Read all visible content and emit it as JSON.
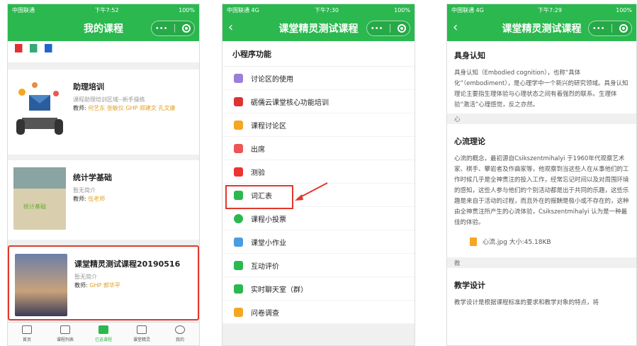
{
  "statusbar": {
    "p1": {
      "carrier": "中国联通",
      "time": "下午7:52",
      "battery": "100%"
    },
    "p2": {
      "carrier": "中国联通 4G",
      "time": "下午7:30",
      "battery": "100%"
    },
    "p3": {
      "carrier": "中国联通 4G",
      "time": "下午7:29",
      "battery": "100%"
    }
  },
  "screen1": {
    "title": "我的课程",
    "courses": [
      {
        "title": "助理培训",
        "desc": "课程助理培训区域--新手操练",
        "teacher_label": "教师:",
        "teachers": "何艺东 张敏仪 GHP 郑建文 孔文康"
      },
      {
        "title": "统计学基础",
        "desc": "暂无简介",
        "teacher_label": "教师:",
        "teachers": "伍老师"
      },
      {
        "title": "课堂精灵测试课程20190516",
        "desc": "暂无简介",
        "teacher_label": "教师:",
        "teachers": "GHP 郭华平"
      }
    ],
    "tabs": [
      "首页",
      "课程列表",
      "已选课程",
      "课堂精灵",
      "我的"
    ]
  },
  "screen2": {
    "title": "课堂精灵测试课程",
    "section": "小程序功能",
    "menu": [
      "讨论区的使用",
      "砺儒云课堂核心功能培训",
      "课程讨论区",
      "出席",
      "测验",
      "词汇表",
      "课程小投票",
      "课堂小作业",
      "互动评价",
      "实时聊天室（群）",
      "问卷调查"
    ]
  },
  "screen3": {
    "title": "课堂精灵测试课程",
    "h1": "具身认知",
    "p1": "具身认知（Embodied cognition），也称“具体化”（embodiment），是心理学中一个新兴的研究领域。具身认知理论主要指生理体验与心理状态之间有着强烈的联系。生理体验“激活”心理感觉，反之亦然。",
    "band1": "心",
    "h2": "心流理论",
    "p2": "心流的概念，最初源自Csikszentmihalyi 于1960年代观察艺术家、棋手、攀岩者及作曲家等，他观察到当这些人在从事他们的工作时候几乎是全神贯注的投入工作，经常忘记时间以及对周围环境的感知，这些人参与他们的个别活动都是出于共同的乐趣，这些乐趣是来自于活动的过程，而且外在的报酬是极小或不存在的，这种由全神贯注所产生的心流体验，Csikszentmihalyi 认为是一种最佳的体验。",
    "file": "心流.jpg 大小:45.18KB",
    "band2": "教",
    "h3": "教学设计",
    "p3": "教学设计是根据课程标准的要求和教学对象的特点，将"
  },
  "colors": {
    "brand": "#2bb84f",
    "highlight": "#e0392b",
    "teacher": "#e0a020"
  }
}
